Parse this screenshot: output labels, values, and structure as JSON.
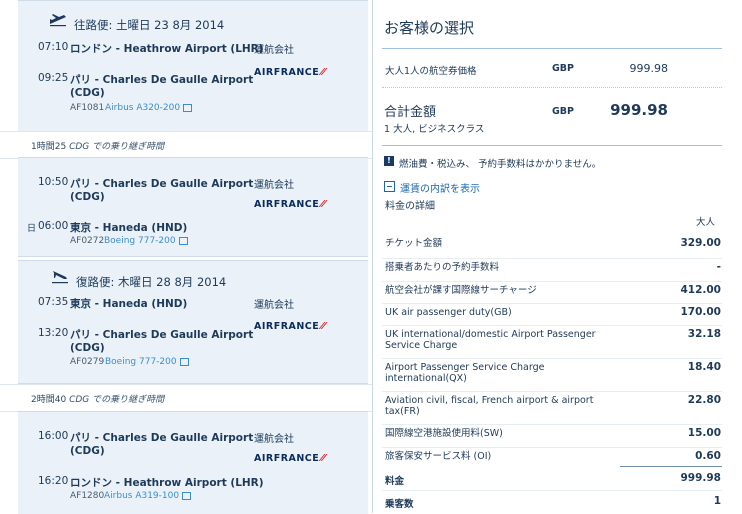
{
  "outbound": {
    "header": "往路便: 土曜日 23 8月 2014",
    "seg1": {
      "dep_time": "07:10",
      "dep_place": "ロンドン - Heathrow Airport (LHR)",
      "operator": "運航会社",
      "arr_time": "09:25",
      "arr_place_1": "パリ - Charles De Gaulle Airport",
      "arr_place_2": "(CDG)",
      "airline": "AIRFRANCE",
      "flight": "AF1081",
      "aircraft": "Airbus A320-200"
    },
    "layover": {
      "duration": "1時間25",
      "text": "CDG での乗り継ぎ時間"
    },
    "seg2": {
      "dep_time": "10:50",
      "dep_place_1": "パリ - Charles De Gaulle Airport",
      "dep_place_2": "(CDG)",
      "operator": "運航会社",
      "airline": "AIRFRANCE",
      "day_marker": "日",
      "arr_time": "06:00",
      "arr_place": "東京 - Haneda (HND)",
      "flight": "AF0272",
      "aircraft": "Boeing 777-200"
    }
  },
  "inbound": {
    "header": "復路便: 木曜日 28 8月 2014",
    "seg1": {
      "dep_time": "07:35",
      "dep_place": "東京 - Haneda (HND)",
      "operator": "運航会社",
      "arr_time": "13:20",
      "arr_place_1": "パリ - Charles De Gaulle Airport",
      "arr_place_2": "(CDG)",
      "airline": "AIRFRANCE",
      "flight": "AF0279",
      "aircraft": "Boeing 777-200"
    },
    "layover": {
      "duration": "2時間40",
      "text": "CDG での乗り継ぎ時間"
    },
    "seg2": {
      "dep_time": "16:00",
      "dep_place_1": "パリ - Charles De Gaulle Airport",
      "dep_place_2": "(CDG)",
      "operator": "運航会社",
      "airline": "AIRFRANCE",
      "arr_time": "16:20",
      "arr_place": "ロンドン - Heathrow Airport (LHR)",
      "flight": "AF1280",
      "aircraft": "Airbus A319-100"
    }
  },
  "summary": {
    "title": "お客様の選択",
    "adult_fare_label": "大人1人の航空券価格",
    "currency": "GBP",
    "adult_fare_value": "999.98",
    "total_label": "合計金額",
    "total_sub": "1 大人, ビジネスクラス",
    "total_value": "999.98",
    "notice": "燃油費・税込み、 予約手数料はかかりません。",
    "breakdown_link": "運賃の内訳を表示",
    "details_title": "料金の詳細",
    "col_header": "大人",
    "rows": [
      {
        "label": "チケット金額",
        "value": "329.00"
      },
      {
        "label": "搭乗者あたりの予約手数料",
        "value": "-"
      },
      {
        "label": "航空会社が課す国際線サーチャージ",
        "value": "412.00"
      },
      {
        "label": "UK air passenger duty(GB)",
        "value": "170.00"
      },
      {
        "label": "UK international/domestic Airport Passenger Service Charge",
        "value": "32.18"
      },
      {
        "label": "Airport Passenger Service Charge international(QX)",
        "value": "18.40"
      },
      {
        "label": "Aviation civil, fiscal, French airport & airport tax(FR)",
        "value": "22.80"
      },
      {
        "label": "国際線空港施設使用料(SW)",
        "value": "15.00"
      },
      {
        "label": "旅客保安サービス料 (OI)",
        "value": "0.60"
      }
    ],
    "fare_label": "料金",
    "fare_value": "999.98",
    "pax_label": "乗客数",
    "pax_value": "1"
  },
  "colors": {
    "accent": "#1a68b3",
    "panel": "#eaf1f8",
    "airfrance_red": "#d32a2a"
  }
}
